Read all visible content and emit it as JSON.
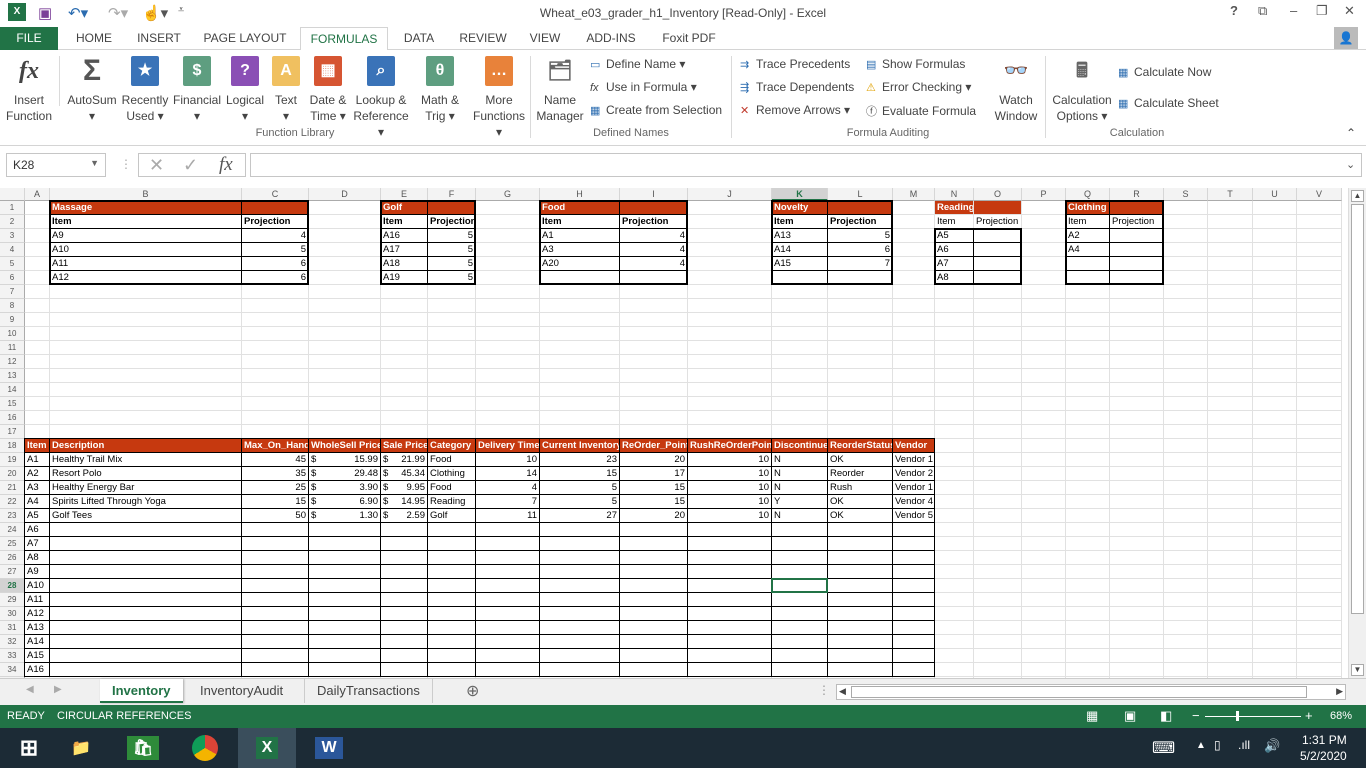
{
  "window": {
    "title": "Wheat_e03_grader_h1_Inventory  [Read-Only] - Excel",
    "help": "?",
    "controls": [
      "⧉",
      "–",
      "❐",
      "✕"
    ]
  },
  "ribbon_tabs": [
    "FILE",
    "HOME",
    "INSERT",
    "PAGE LAYOUT",
    "FORMULAS",
    "DATA",
    "REVIEW",
    "VIEW",
    "ADD-INS",
    "Foxit PDF"
  ],
  "ribbon": {
    "function_library": {
      "label": "Function Library",
      "insert_function": [
        "Insert",
        "Function"
      ],
      "buttons": [
        {
          "l1": "AutoSum",
          "l2": "▾",
          "icon": "Σ",
          "color": "#555555"
        },
        {
          "l1": "Recently",
          "l2": "Used ▾",
          "icon": "★",
          "color": "#3a73b8"
        },
        {
          "l1": "Financial",
          "l2": "▾",
          "icon": "$",
          "color": "#5e9e80"
        },
        {
          "l1": "Logical",
          "l2": "▾",
          "icon": "?",
          "color": "#8a4fb5"
        },
        {
          "l1": "Text",
          "l2": "▾",
          "icon": "A",
          "color": "#f0c060"
        },
        {
          "l1": "Date &",
          "l2": "Time ▾",
          "icon": "▦",
          "color": "#d65532"
        },
        {
          "l1": "Lookup &",
          "l2": "Reference ▾",
          "icon": "⌕",
          "color": "#3a73b8"
        },
        {
          "l1": "Math &",
          "l2": "Trig ▾",
          "icon": "θ",
          "color": "#5e9e80"
        },
        {
          "l1": "More",
          "l2": "Functions ▾",
          "icon": "…",
          "color": "#e8823a"
        }
      ]
    },
    "defined_names": {
      "label": "Defined Names",
      "name_manager": [
        "Name",
        "Manager"
      ],
      "define_name": "Define Name ▾",
      "use_in_formula": "Use in Formula ▾",
      "create_from_selection": "Create from Selection"
    },
    "formula_auditing": {
      "label": "Formula Auditing",
      "trace_precedents": "Trace Precedents",
      "trace_dependents": "Trace Dependents",
      "remove_arrows": "Remove Arrows ▾",
      "show_formulas": "Show Formulas",
      "error_checking": "Error Checking ▾",
      "evaluate_formula": "Evaluate Formula",
      "watch_window": [
        "Watch",
        "Window"
      ]
    },
    "calculation": {
      "label": "Calculation",
      "options": [
        "Calculation",
        "Options ▾"
      ],
      "calculate_now": "Calculate Now",
      "calculate_sheet": "Calculate Sheet"
    }
  },
  "formula_bar": {
    "name_box": "K28",
    "formula": "",
    "fx": "fx",
    "cancel": "✕",
    "enter": "✓"
  },
  "grid": {
    "columns": [
      "A",
      "B",
      "C",
      "D",
      "E",
      "F",
      "G",
      "H",
      "I",
      "J",
      "K",
      "L",
      "M",
      "N",
      "O",
      "P",
      "Q",
      "R",
      "S",
      "T",
      "U",
      "V"
    ],
    "selected_cell": "K28",
    "currency_symbol": "$",
    "cells": {
      "B1": "Massage",
      "B2": "Item",
      "C2": "Projection",
      "B3": "A9",
      "C3": "4",
      "B4": "A10",
      "C4": "5",
      "B5": "A11",
      "C5": "6",
      "B6": "A12",
      "C6": "6",
      "E1": "Golf",
      "E2": "Item",
      "F2": "Projection",
      "E3": "A16",
      "F3": "5",
      "E4": "A17",
      "F4": "5",
      "E5": "A18",
      "F5": "5",
      "E6": "A19",
      "F6": "5",
      "H1": "Food",
      "H2": "Item",
      "I2": "Projection",
      "H3": "A1",
      "I3": "4",
      "H4": "A3",
      "I4": "4",
      "H5": "A20",
      "I5": "4",
      "K1": "Novelty",
      "K2": "Item",
      "L2": "Projection",
      "K3": "A13",
      "L3": "5",
      "K4": "A14",
      "L4": "6",
      "K5": "A15",
      "L5": "7",
      "N1": "Reading",
      "N2": "Item",
      "O2": "Projection",
      "N3": "A5",
      "N4": "A6",
      "N5": "A7",
      "N6": "A8",
      "Q1": "Clothing",
      "Q2": "Item",
      "R2": "Projection",
      "Q3": "A2",
      "Q4": "A4",
      "A18": "Item",
      "B18": "Description",
      "C18": "Max_On_Hand",
      "D18": "WholeSell Price",
      "E18": "Sale Price",
      "F18": "Category",
      "G18": "Delivery Time",
      "H18": "Current Inventory",
      "I18": "ReOrder_Point",
      "J18": "RushReOrderPoint",
      "K18": "Discontinued",
      "L18": "ReorderStatus",
      "M18": "Vendor",
      "A19": "A1",
      "B19": "Healthy Trail Mix",
      "C19": "45",
      "D19": "15.99",
      "E19": "21.99",
      "F19": "Food",
      "G19": "10",
      "H19": "23",
      "I19": "20",
      "J19": "10",
      "K19": "N",
      "L19": "OK",
      "M19": "Vendor 1",
      "A20": "A2",
      "B20": "Resort Polo",
      "C20": "35",
      "D20": "29.48",
      "E20": "45.34",
      "F20": "Clothing",
      "G20": "14",
      "H20": "15",
      "I20": "17",
      "J20": "10",
      "K20": "N",
      "L20": "Reorder",
      "M20": "Vendor 2",
      "A21": "A3",
      "B21": "Healthy Energy Bar",
      "C21": "25",
      "D21": "3.90",
      "E21": "9.95",
      "F21": "Food",
      "G21": "4",
      "H21": "5",
      "I21": "15",
      "J21": "10",
      "K21": "N",
      "L21": "Rush",
      "M21": "Vendor 1",
      "A22": "A4",
      "B22": "Spirits Lifted Through Yoga",
      "C22": "15",
      "D22": "6.90",
      "E22": "14.95",
      "F22": "Reading",
      "G22": "7",
      "H22": "5",
      "I22": "15",
      "J22": "10",
      "K22": "Y",
      "L22": "OK",
      "M22": "Vendor 4",
      "A23": "A5",
      "B23": "Golf Tees",
      "C23": "50",
      "D23": "1.30",
      "E23": "2.59",
      "F23": "Golf",
      "G23": "11",
      "H23": "27",
      "I23": "20",
      "J23": "10",
      "K23": "N",
      "L23": "OK",
      "M23": "Vendor 5",
      "A24": "A6",
      "A25": "A7",
      "A26": "A8",
      "A27": "A9",
      "A28": "A10",
      "A29": "A11",
      "A30": "A12",
      "A31": "A13",
      "A32": "A14",
      "A33": "A15",
      "A34": "A16"
    }
  },
  "sheets": [
    "Inventory",
    "InventoryAudit",
    "DailyTransactions"
  ],
  "active_sheet": "Inventory",
  "status": {
    "ready": "READY",
    "circular": "CIRCULAR REFERENCES",
    "zoom": "68%"
  },
  "taskbar": {
    "time": "1:31 PM",
    "date": "5/2/2020",
    "apps": [
      "File Explorer",
      "Store",
      "Chrome",
      "Excel",
      "Word"
    ]
  },
  "colors": {
    "excel_green": "#217346",
    "header_orange": "#c6390f"
  }
}
